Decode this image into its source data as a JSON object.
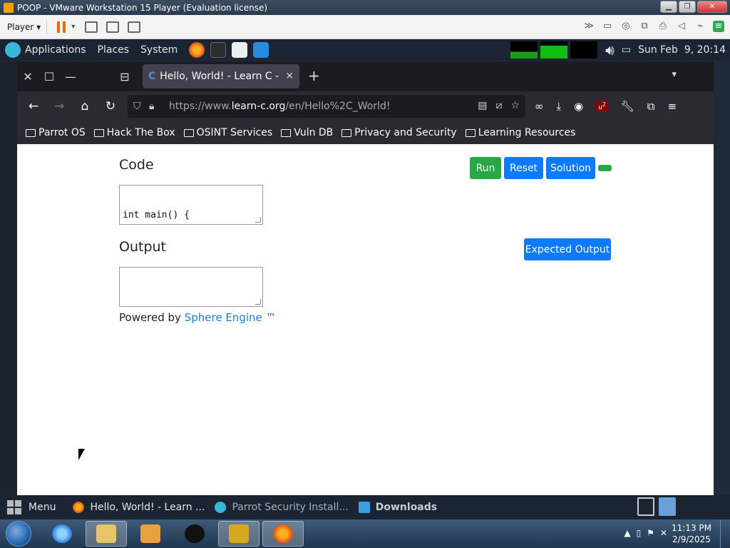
{
  "vm": {
    "title": "POOP - VMware Workstation 15 Player (Evaluation license)",
    "player_label": "Player"
  },
  "top_panel": {
    "menus": [
      "Applications",
      "Places",
      "System"
    ],
    "datetime": "Sun Feb  9, 20:14"
  },
  "browser": {
    "tab_title": "Hello, World! - Learn C - F",
    "tab_favicon": "C",
    "url_prefix": "https://www.",
    "url_domain": "learn-c.org",
    "url_path": "/en/Hello%2C_World!",
    "ublock_count": "2",
    "bookmarks": [
      "Parrot OS",
      "Hack The Box",
      "OSINT Services",
      "Vuln DB",
      "Privacy and Security",
      "Learning Resources"
    ]
  },
  "page": {
    "code_heading": "Code",
    "code_value": "int main() {",
    "output_heading": "Output",
    "run_label": "Run",
    "reset_label": "Reset",
    "solution_label": "Solution",
    "expected_output_label": "Expected Output",
    "powered_by": "Powered by ",
    "powered_link": "Sphere Engine ™"
  },
  "bottom_panel": {
    "menu_label": "Menu",
    "tasks": [
      {
        "label": "Hello, World! - Learn ...",
        "icon": "firefox-icon"
      },
      {
        "label": "Parrot Security Install...",
        "icon": "parrot-icon"
      },
      {
        "label": "Downloads",
        "icon": "folder-icon"
      }
    ]
  },
  "win_taskbar": {
    "time": "11:13 PM",
    "date": "2/9/2025"
  },
  "colors": {
    "run_green": "#28a745",
    "primary_blue": "#0d7bff",
    "link_blue": "#1e7fcf"
  }
}
